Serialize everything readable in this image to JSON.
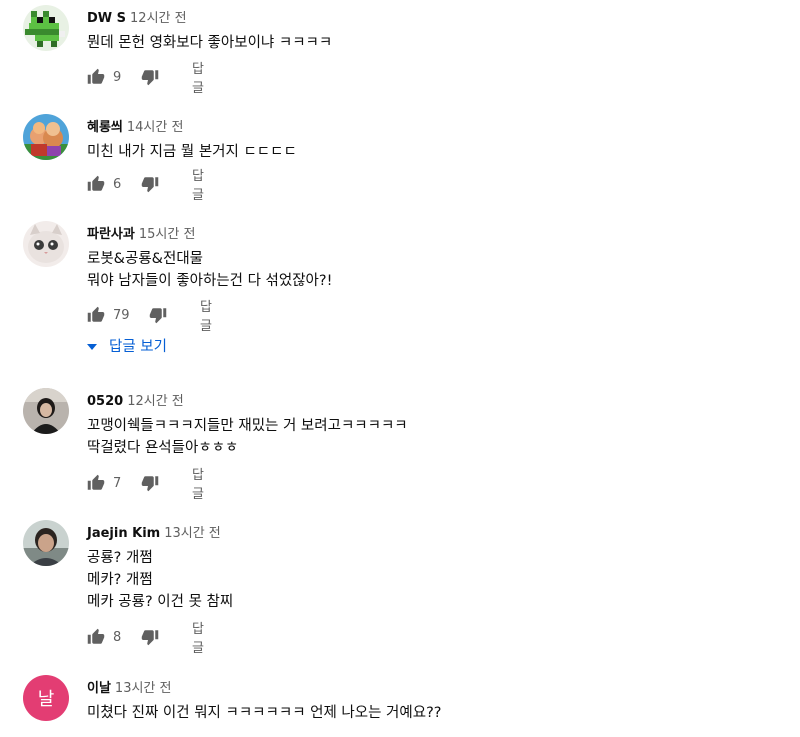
{
  "comments": [
    {
      "author": "DW S",
      "time": "12시간 전",
      "lines": [
        "뭔데 몬헌 영화보다 좋아보이냐 ㅋㅋㅋㅋ"
      ],
      "likes": "9",
      "reply_label": "답글"
    },
    {
      "author": "혜롱씌",
      "time": "14시간 전",
      "lines": [
        "미친 내가 지금 뭘 본거지 ㄷㄷㄷㄷ"
      ],
      "likes": "6",
      "reply_label": "답글"
    },
    {
      "author": "파란사과",
      "time": "15시간 전",
      "lines": [
        "로봇&공룡&전대물",
        "뭐야 남자들이 좋아하는건 다 섞었잖아?!"
      ],
      "likes": "79",
      "reply_label": "답글",
      "view_replies": "답글 보기"
    },
    {
      "author": "0520",
      "time": "12시간 전",
      "lines": [
        "꼬맹이쉑들ㅋㅋㅋ지들만 재밌는 거 보려고ㅋㅋㅋㅋㅋ",
        "딱걸렸다 욘석들아ㅎㅎㅎ"
      ],
      "likes": "7",
      "reply_label": "답글"
    },
    {
      "author": "Jaejin Kim",
      "time": "13시간 전",
      "lines": [
        "공룡? 개쩜",
        "메카? 개쩜",
        "메카 공룡? 이건 못 참찌"
      ],
      "likes": "8",
      "reply_label": "답글"
    },
    {
      "author": "이날",
      "time": "13시간 전",
      "lines": [
        "미쳤다 진짜 이건 뭐지 ㅋㅋㅋㅋㅋㅋ 언제 나오는 거예요??"
      ],
      "avatar_letter": "날"
    }
  ],
  "colors": {
    "link": "#065fd4",
    "muted": "#606060",
    "avatar_pink": "#e33d73"
  },
  "icons": {
    "like": "thumbs-up-icon",
    "dislike": "thumbs-down-icon",
    "expand": "caret-down-icon"
  }
}
